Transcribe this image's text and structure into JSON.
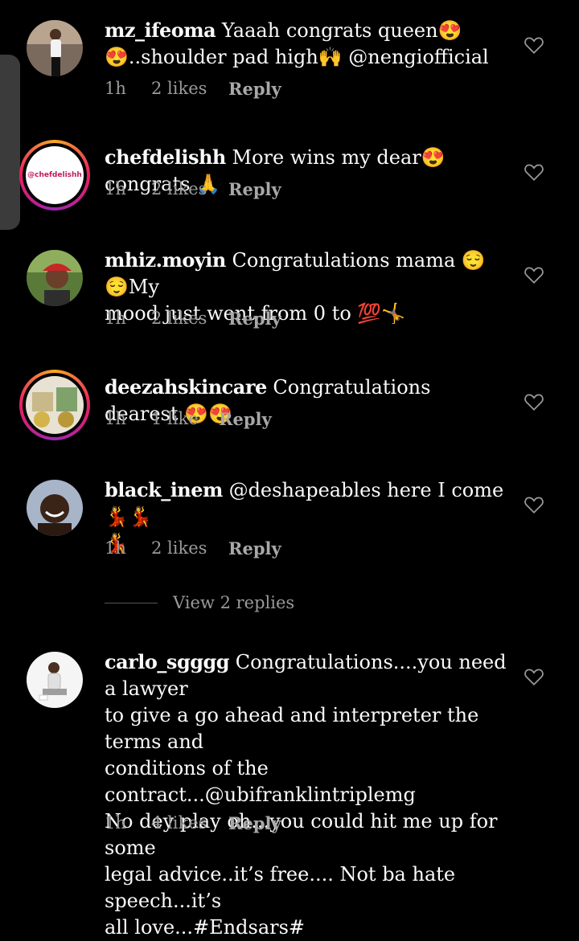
{
  "comments": [
    {
      "username": "mz_ifeoma",
      "text_line1": "Yaaah congrats queen😍",
      "text_line2": "😍..shoulder pad high🙌 @nengiofficial",
      "time": "1h",
      "likes": "2 likes",
      "reply": "Reply"
    },
    {
      "username": "chefdelishh",
      "text_line1": "More wins my dear😍 congrats 🙏",
      "time": "1h",
      "likes": "2 likes",
      "reply": "Reply",
      "avatar_text": "@chefdelishh"
    },
    {
      "username": "mhiz.moyin",
      "text_line1": "Congratulations mama 😌😌My",
      "text_line2": "mood just went from 0 to 💯🤸",
      "time": "1h",
      "likes": "2 likes",
      "reply": "Reply"
    },
    {
      "username": "deezahskincare",
      "text_line1": "Congratulations dearest 😍😍",
      "time": "1h",
      "likes": "1 like",
      "reply": "Reply"
    },
    {
      "username": "black_inem",
      "text_line1": "@deshapeables here I come💃💃",
      "text_line2": "💃",
      "time": "1h",
      "likes": "2 likes",
      "reply": "Reply"
    },
    {
      "username": "carlo_sgggg",
      "text_line1": "Congratulations....you need a lawyer",
      "text_line2": "to give a go ahead and interpreter the terms and",
      "text_line3": "conditions of the contract...@ubifranklintriplemg",
      "text_line4": "No dey play oh...you could hit me up for some",
      "text_line5": "legal advice..it’s free.... Not ba hate speech...it’s",
      "text_line6": "all love...#Endsars#",
      "time": "1h",
      "likes": "4 likes",
      "reply": "Reply"
    }
  ],
  "view_replies": "View 2 replies",
  "colors": {
    "background": "#000000",
    "meta_text": "#9a9a9a",
    "text": "#fafafa"
  }
}
